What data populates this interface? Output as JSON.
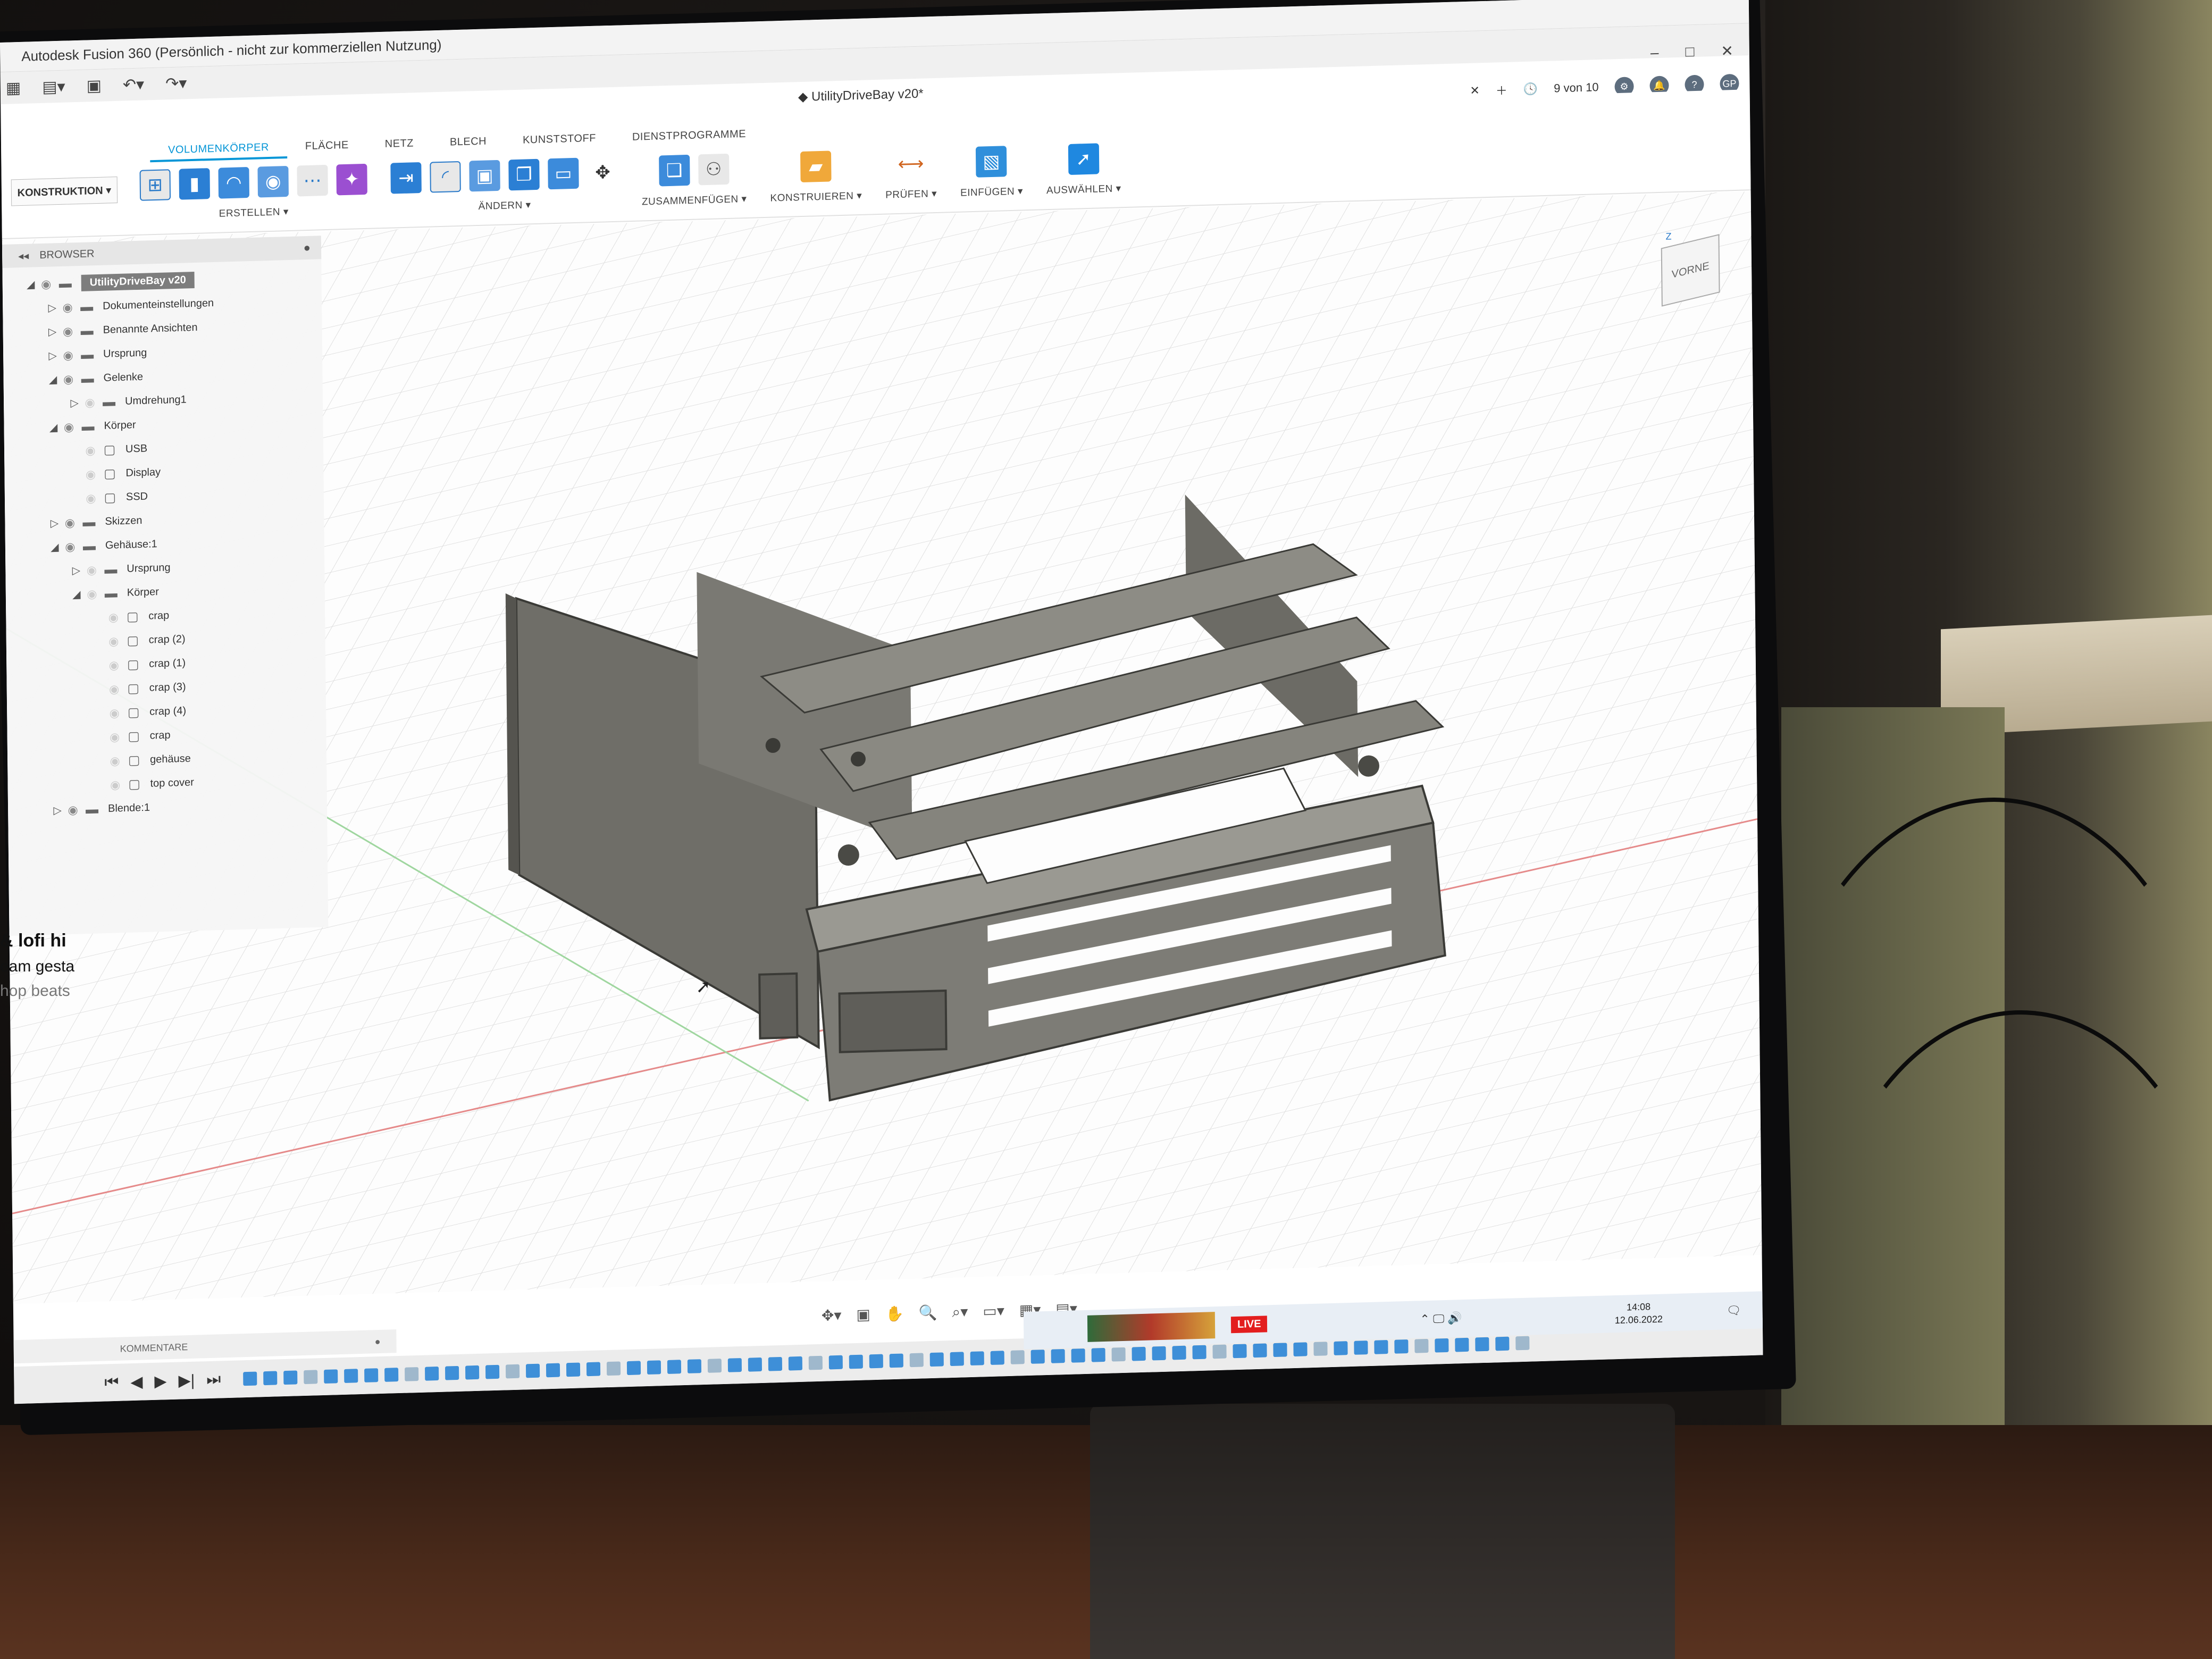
{
  "window": {
    "app_title": "Autodesk Fusion 360 (Persönlich - nicht zur kommerziellen Nutzung)",
    "document_title": "UtilityDriveBay v20*",
    "controls": [
      "–",
      "□",
      "✕"
    ]
  },
  "top_right": {
    "job_status": "9 von 10",
    "avatar": "GP"
  },
  "toolbar": {
    "workspace": "KONSTRUKTION ▾",
    "tabs": [
      "VOLUMENKÖRPER",
      "FLÄCHE",
      "NETZ",
      "BLECH",
      "KUNSTSTOFF",
      "DIENSTPROGRAMME"
    ],
    "active_tab": "VOLUMENKÖRPER",
    "groups": [
      {
        "label": "ERSTELLEN ▾"
      },
      {
        "label": "ÄNDERN ▾"
      },
      {
        "label": "ZUSAMMENFÜGEN ▾"
      },
      {
        "label": "KONSTRUIEREN ▾"
      },
      {
        "label": "PRÜFEN ▾"
      },
      {
        "label": "EINFÜGEN ▾"
      },
      {
        "label": "AUSWÄHLEN ▾"
      }
    ]
  },
  "browser": {
    "title": "BROWSER",
    "items": [
      {
        "label": "UtilityDriveBay v20",
        "level": 0,
        "expanded": true,
        "root": true
      },
      {
        "label": "Dokumenteinstellungen",
        "level": 1,
        "expanded": false
      },
      {
        "label": "Benannte Ansichten",
        "level": 1,
        "expanded": false
      },
      {
        "label": "Ursprung",
        "level": 1,
        "expanded": false
      },
      {
        "label": "Gelenke",
        "level": 1,
        "expanded": true
      },
      {
        "label": "Umdrehung1",
        "level": 2,
        "expanded": false
      },
      {
        "label": "Körper",
        "level": 1,
        "expanded": true
      },
      {
        "label": "USB",
        "level": 2
      },
      {
        "label": "Display",
        "level": 2
      },
      {
        "label": "SSD",
        "level": 2
      },
      {
        "label": "Skizzen",
        "level": 1,
        "expanded": false
      },
      {
        "label": "Gehäuse:1",
        "level": 1,
        "expanded": true
      },
      {
        "label": "Ursprung",
        "level": 2,
        "expanded": false
      },
      {
        "label": "Körper",
        "level": 2,
        "expanded": true
      },
      {
        "label": "crap",
        "level": 3
      },
      {
        "label": "crap (2)",
        "level": 3
      },
      {
        "label": "crap (1)",
        "level": 3
      },
      {
        "label": "crap (3)",
        "level": 3
      },
      {
        "label": "crap (4)",
        "level": 3
      },
      {
        "label": "crap",
        "level": 3
      },
      {
        "label": "gehäuse",
        "level": 3
      },
      {
        "label": "top cover",
        "level": 3
      },
      {
        "label": "Blende:1",
        "level": 1,
        "expanded": false
      }
    ]
  },
  "viewcube": {
    "face": "VORNE",
    "axis_label": "Z"
  },
  "comments": {
    "label": "KOMMENTARE"
  },
  "taskbar": {
    "live_label": "LIVE",
    "time": "14:08",
    "date": "12.06.2022"
  },
  "background_window": {
    "text_lines": [
      "& lofi hi",
      "eam gesta",
      "hop beats"
    ]
  }
}
